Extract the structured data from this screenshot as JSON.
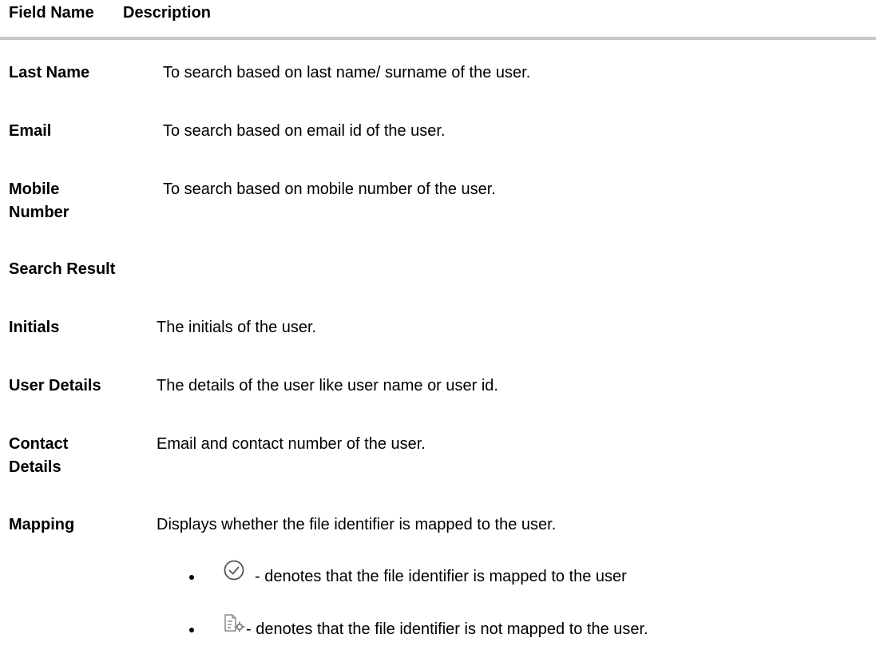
{
  "header": {
    "field_name": "Field Name",
    "description": "Description"
  },
  "fields": [
    {
      "name": "Last Name",
      "description": "To search based on last name/ surname of the user."
    },
    {
      "name": "Email",
      "description": "To search based on email id of the user."
    },
    {
      "name_line1": "Mobile",
      "name_line2": "Number",
      "description": "To search based on mobile number of the user."
    }
  ],
  "section_title": "Search Result",
  "results": [
    {
      "name": "Initials",
      "description": "The initials of the user."
    },
    {
      "name": "User Details",
      "description": "The details of the user like user name or user id."
    },
    {
      "name_line1": "Contact",
      "name_line2": "Details",
      "description": "Email and contact number of the user."
    },
    {
      "name": "Mapping",
      "description": "Displays whether the file identifier is mapped to the user."
    }
  ],
  "mapping_bullets": [
    {
      "icon": "check-circle-icon",
      "text": "- denotes that the file identifier is mapped to the user"
    },
    {
      "icon": "document-settings-icon",
      "text": "- denotes that the file identifier is not mapped to the user."
    }
  ]
}
